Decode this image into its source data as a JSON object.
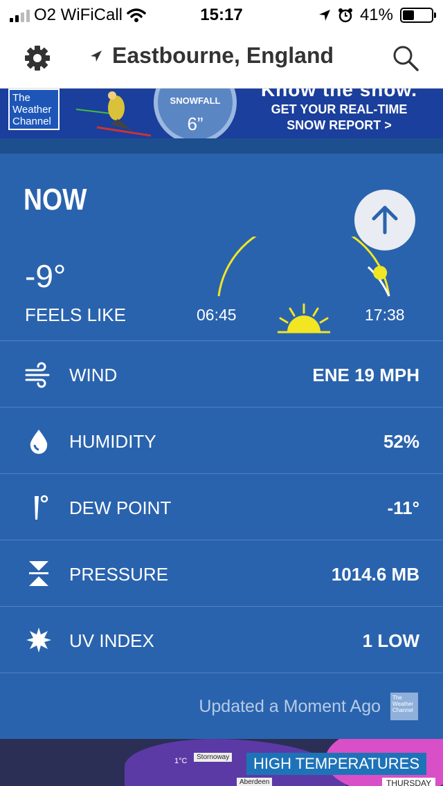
{
  "status_bar": {
    "carrier": "O2 WiFiCall",
    "time": "15:17",
    "battery": "41%",
    "battery_level": 0.41
  },
  "header": {
    "location": "Eastbourne, England",
    "settings_icon": "gear-icon",
    "search_icon": "search-icon",
    "location_icon": "location-arrow-icon"
  },
  "ad": {
    "logo_line1": "The",
    "logo_line2": "Weather",
    "logo_line3": "Channel",
    "snow_label": "SNOWFALL",
    "snow_amount": "6”",
    "headline": "Know the snow.",
    "line1": "GET YOUR REAL-TIME",
    "line2": "SNOW REPORT >"
  },
  "now": {
    "title": "NOW",
    "temperature": "-9°",
    "feels_like_label": "FEELS LIKE",
    "sunrise": "06:45",
    "sunset": "17:38",
    "sun_progress": 0.92
  },
  "details": [
    {
      "label": "WIND",
      "value": "ENE 19 MPH",
      "icon": "wind-icon"
    },
    {
      "label": "HUMIDITY",
      "value": "52%",
      "icon": "drop-icon"
    },
    {
      "label": "DEW POINT",
      "value": "-11°",
      "icon": "thermometer-icon"
    },
    {
      "label": "PRESSURE",
      "value": "1014.6 MB",
      "icon": "pressure-icon"
    },
    {
      "label": "UV INDEX",
      "value": "1 LOW",
      "icon": "uv-sun-icon"
    }
  ],
  "updated": {
    "text": "Updated a Moment Ago",
    "logo_line1": "The",
    "logo_line2": "Weather",
    "logo_line3": "Channel"
  },
  "map": {
    "temp_tag": "1°C",
    "city1": "Stornoway",
    "city2": "Aberdeen",
    "title": "HIGH TEMPERATURES",
    "day": "THURSDAY"
  },
  "colors": {
    "panel": "#2a63ad",
    "sun_yellow": "#f2e623",
    "dark_band": "#1d4f8f"
  }
}
